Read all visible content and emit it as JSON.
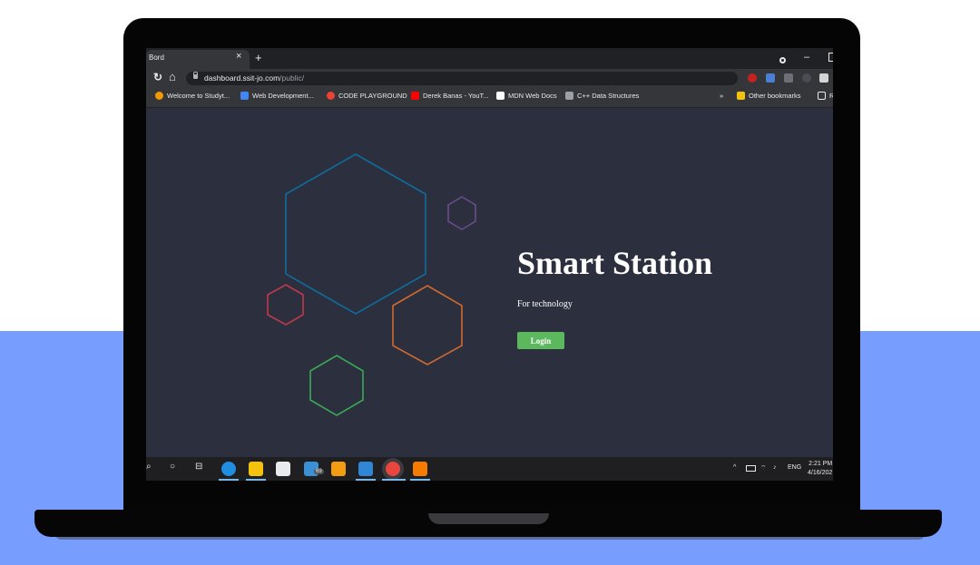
{
  "browser": {
    "tab_title": "Bord",
    "tab_close": "×",
    "new_tab": "+",
    "window_min": "–",
    "reload_icon": "↻",
    "home_icon": "⌂",
    "url_host": "dashboard.ssit-jo.com",
    "url_path": "/public/",
    "bookmark_star": "☆",
    "bookmarks": [
      {
        "label": "Welcome to Studyt...",
        "color": "#f29900"
      },
      {
        "label": "Web Development...",
        "color": "#4285f4"
      },
      {
        "label": "CODE PLAYGROUND",
        "color": "#ea4335"
      },
      {
        "label": "Derek Banas - YouT...",
        "color": "#ff0000"
      },
      {
        "label": "MDN Web Docs",
        "color": "#ffffff"
      },
      {
        "label": "C++ Data Structures",
        "color": "#9aa0a6"
      }
    ],
    "more_bookmarks": "»",
    "other_bookmarks": "Other bookmarks",
    "reading_list_abbrev": "R"
  },
  "page": {
    "title": "Smart Station",
    "subtitle": "For technology",
    "login_label": "Login",
    "hexagon_colors": [
      "#0e6c9b",
      "#6b4b8f",
      "#c0394b",
      "#d06a2f",
      "#3aa857"
    ]
  },
  "taskbar": {
    "search_icon": "⌕",
    "cortana_icon": "○",
    "taskview_icon": "⊟",
    "mail_badge": "69",
    "tray_chevron": "^",
    "language": "ENG",
    "time": "2:21 PM",
    "date": "4/16/202"
  },
  "colors": {
    "page_background": "#2c2f3e",
    "backdrop": "#779dff",
    "login_button": "#5cb85c"
  }
}
